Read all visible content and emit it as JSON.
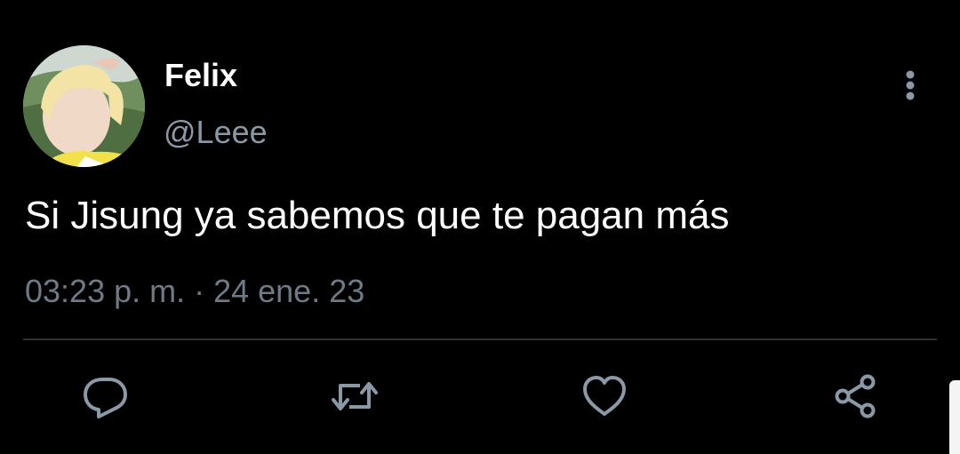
{
  "tweet": {
    "author": {
      "display_name": "Felix",
      "handle": "@Leee",
      "avatar": "profile-photo"
    },
    "text": "Si Jisung ya sabemos que te pagan más",
    "timestamp": "03:23 p. m. · 24 ene. 23"
  },
  "actions": [
    {
      "name": "reply",
      "icon": "comment-icon"
    },
    {
      "name": "retweet",
      "icon": "retweet-icon"
    },
    {
      "name": "like",
      "icon": "heart-icon"
    },
    {
      "name": "share",
      "icon": "share-icon"
    }
  ],
  "colors": {
    "background": "#000000",
    "primary_text": "#ffffff",
    "secondary_text": "#8b98a5",
    "icon": "#8b98a5",
    "divider": "#2f3336"
  }
}
